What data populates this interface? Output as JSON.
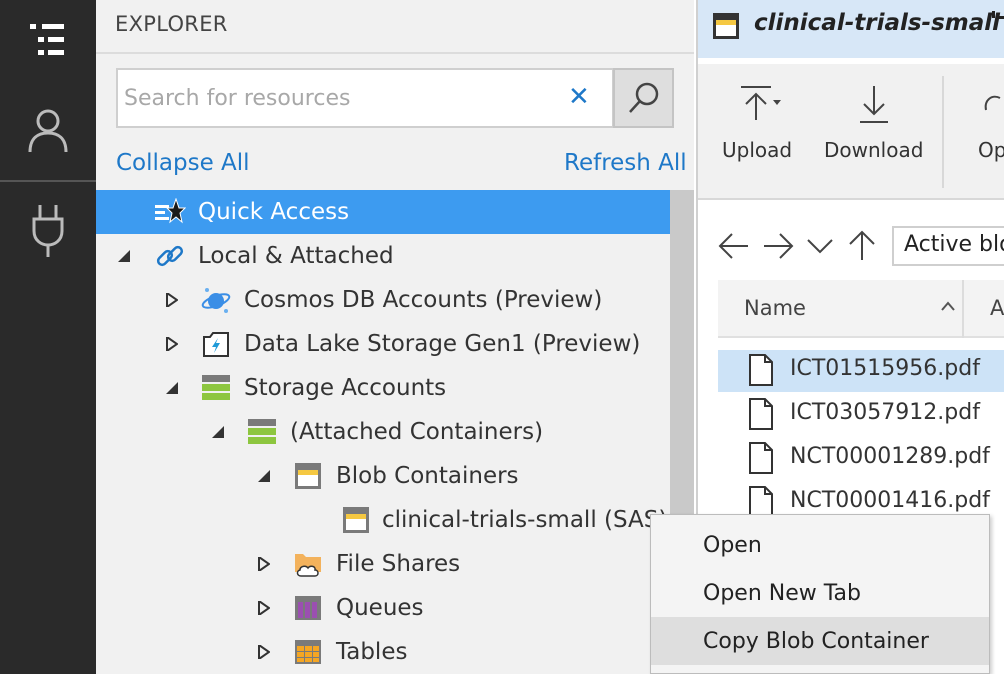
{
  "activity_bar": {
    "items": [
      {
        "name": "explorer-icon"
      },
      {
        "name": "account-icon"
      },
      {
        "name": "plug-icon"
      }
    ]
  },
  "explorer": {
    "title": "EXPLORER",
    "search": {
      "placeholder": "Search for resources",
      "value": ""
    },
    "collapse_all": "Collapse All",
    "refresh_all": "Refresh All",
    "tree": [
      {
        "label": "Quick Access",
        "selected": true
      },
      {
        "label": "Local & Attached"
      },
      {
        "label": "Cosmos DB Accounts (Preview)"
      },
      {
        "label": "Data Lake Storage Gen1 (Preview)"
      },
      {
        "label": "Storage Accounts"
      },
      {
        "label": "(Attached Containers)"
      },
      {
        "label": "Blob Containers"
      },
      {
        "label": "clinical-trials-small (SAS)"
      },
      {
        "label": "File Shares"
      },
      {
        "label": "Queues"
      },
      {
        "label": "Tables"
      }
    ]
  },
  "main": {
    "tab_title": "clinical-trials-small",
    "toolbar": {
      "upload": "Upload",
      "download": "Download",
      "open": "Op"
    },
    "path": "Active blobs",
    "columns": {
      "name": "Name",
      "second": "A"
    },
    "files": [
      {
        "name": "ICT01515956.pdf",
        "selected": true
      },
      {
        "name": "ICT03057912.pdf"
      },
      {
        "name": "NCT00001289.pdf"
      },
      {
        "name": "NCT00001416.pdf"
      }
    ]
  },
  "context_menu": {
    "items": [
      {
        "label": "Open"
      },
      {
        "label": "Open New Tab"
      },
      {
        "label": "Copy Blob Container",
        "highlighted": true
      }
    ]
  },
  "colors": {
    "accent": "#1e78c8",
    "selection": "#3d9bf0",
    "activity_bg": "#2a2a2a"
  }
}
